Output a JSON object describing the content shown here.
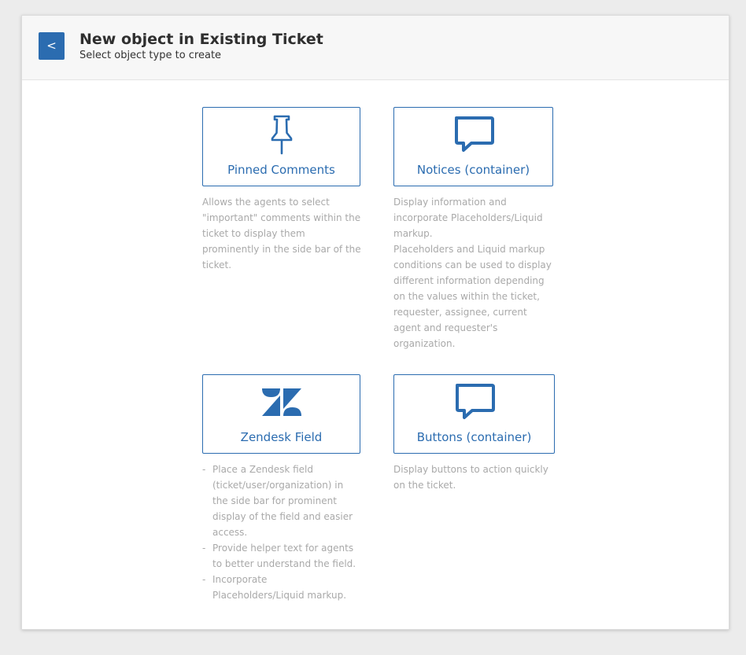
{
  "header": {
    "back_label": "<",
    "title": "New object in Existing Ticket",
    "subtitle": "Select object type to create"
  },
  "cards": [
    {
      "label": "Pinned Comments",
      "icon": "pushpin-icon",
      "description": "Allows the agents to select \"important\" comments within the ticket to display them prominently in the side bar of the ticket."
    },
    {
      "label": "Notices (container)",
      "icon": "speech-bubble-icon",
      "description_lines": [
        "Display information and incorporate Placeholders/Liquid markup.",
        "Placeholders and Liquid markup conditions can be used to display different information depending on the values within the ticket, requester, assignee, current agent and requester's organization."
      ]
    },
    {
      "label": "Zendesk Field",
      "icon": "zendesk-logo-icon",
      "bullets": [
        "Place a Zendesk field (ticket/user/organization) in the side bar for prominent display of the field and easier access.",
        "Provide helper text for agents to better understand the field.",
        "Incorporate Placeholders/Liquid markup."
      ]
    },
    {
      "label": "Buttons (container)",
      "icon": "speech-bubble-icon",
      "description": "Display buttons to action quickly on the ticket."
    }
  ],
  "colors": {
    "accent": "#2b6cb0",
    "muted_text": "#a9a9a9",
    "header_bg": "#f7f7f7"
  }
}
